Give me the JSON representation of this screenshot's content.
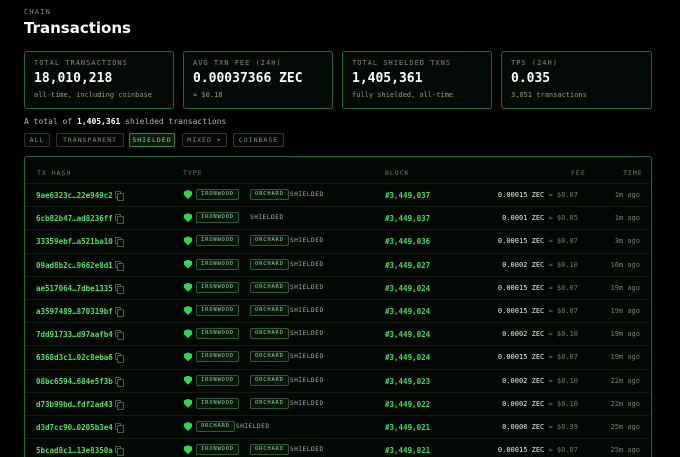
{
  "header": {
    "eyebrow": "CHAIN",
    "title": "Transactions"
  },
  "stats": [
    {
      "label": "TOTAL TRANSACTIONS",
      "value": "18,010,218",
      "sub": "all-time, including coinbase"
    },
    {
      "label": "AVG TXN FEE (24H)",
      "value": "0.00037366 ZEC",
      "sub": "≈ $0.18"
    },
    {
      "label": "TOTAL SHIELDED TXNS",
      "value": "1,405,361",
      "sub": "fully shielded, all-time"
    },
    {
      "label": "TPS (24H)",
      "value": "0.035",
      "sub": "3,051 transactions"
    }
  ],
  "summary": {
    "prefix": "A total of",
    "count": "1,405,361",
    "suffix": "shielded transactions"
  },
  "filters": [
    {
      "label": "ALL",
      "active": false
    },
    {
      "label": "TRANSPARENT",
      "active": false
    },
    {
      "label": "SHIELDED",
      "active": true
    },
    {
      "label": "MIXED ▾",
      "active": false
    },
    {
      "label": "COINBASE",
      "active": false
    }
  ],
  "table": {
    "columns": {
      "hash": "TX HASH",
      "type": "TYPE",
      "block": "BLOCK",
      "fee": "FEE",
      "time": "TIME"
    },
    "rows": [
      {
        "hash": "9ae6323c…22e949c2",
        "pools": [
          "IRONWOOD",
          "ORCHARD"
        ],
        "kind": "SHIELDED",
        "block": "#3,449,037",
        "fee": "0.00015 ZEC",
        "usd": "≈ $0.07",
        "time": "1m ago"
      },
      {
        "hash": "6cb82b47…ad8236ff",
        "pools": [
          "IRONWOOD"
        ],
        "kind": "SHIELDED",
        "block": "#3,449,037",
        "fee": "0.0001 ZEC",
        "usd": "≈ $0.05",
        "time": "1m ago"
      },
      {
        "hash": "33359ebf…a521ba10",
        "pools": [
          "IRONWOOD",
          "ORCHARD"
        ],
        "kind": "SHIELDED",
        "block": "#3,449,036",
        "fee": "0.00015 ZEC",
        "usd": "≈ $0.07",
        "time": "3m ago"
      },
      {
        "hash": "09ad8b2c…9662e8d1",
        "pools": [
          "IRONWOOD",
          "ORCHARD"
        ],
        "kind": "SHIELDED",
        "block": "#3,449,027",
        "fee": "0.0002 ZEC",
        "usd": "≈ $0.10",
        "time": "16m ago"
      },
      {
        "hash": "ae517064…7dbe1335",
        "pools": [
          "IRONWOOD",
          "ORCHARD"
        ],
        "kind": "SHIELDED",
        "block": "#3,449,024",
        "fee": "0.00015 ZEC",
        "usd": "≈ $0.07",
        "time": "19m ago"
      },
      {
        "hash": "a3597489…870319bf",
        "pools": [
          "IRONWOOD",
          "ORCHARD"
        ],
        "kind": "SHIELDED",
        "block": "#3,449,024",
        "fee": "0.00015 ZEC",
        "usd": "≈ $0.07",
        "time": "19m ago"
      },
      {
        "hash": "7dd91733…d97aafb4",
        "pools": [
          "IRONWOOD",
          "ORCHARD"
        ],
        "kind": "SHIELDED",
        "block": "#3,449,024",
        "fee": "0.0002 ZEC",
        "usd": "≈ $0.10",
        "time": "19m ago"
      },
      {
        "hash": "6368d3c1…02c8eba6",
        "pools": [
          "IRONWOOD",
          "ORCHARD"
        ],
        "kind": "SHIELDED",
        "block": "#3,449,024",
        "fee": "0.00015 ZEC",
        "usd": "≈ $0.07",
        "time": "19m ago"
      },
      {
        "hash": "08bc6594…684e5f3b",
        "pools": [
          "IRONWOOD",
          "ORCHARD"
        ],
        "kind": "SHIELDED",
        "block": "#3,449,023",
        "fee": "0.0002 ZEC",
        "usd": "≈ $0.10",
        "time": "22m ago"
      },
      {
        "hash": "d73b99bd…fdf2ad43",
        "pools": [
          "IRONWOOD",
          "ORCHARD"
        ],
        "kind": "SHIELDED",
        "block": "#3,449,022",
        "fee": "0.0002 ZEC",
        "usd": "≈ $0.10",
        "time": "22m ago"
      },
      {
        "hash": "d3d7cc90…0205b3e4",
        "pools": [
          "ORCHARD"
        ],
        "kind": "SHIELDED",
        "block": "#3,449,021",
        "fee": "0.0008 ZEC",
        "usd": "≈ $0.39",
        "time": "25m ago"
      },
      {
        "hash": "5bcad8c1…13e8350a",
        "pools": [
          "IRONWOOD",
          "ORCHARD"
        ],
        "kind": "SHIELDED",
        "block": "#3,449,021",
        "fee": "0.00015 ZEC",
        "usd": "≈ $0.07",
        "time": "25m ago"
      }
    ]
  },
  "colors": {
    "accent": "#2bd94a",
    "border": "#1f6a2c",
    "background": "#000000"
  },
  "icons": {
    "copy": "copy-icon",
    "type": "shield-icon"
  }
}
